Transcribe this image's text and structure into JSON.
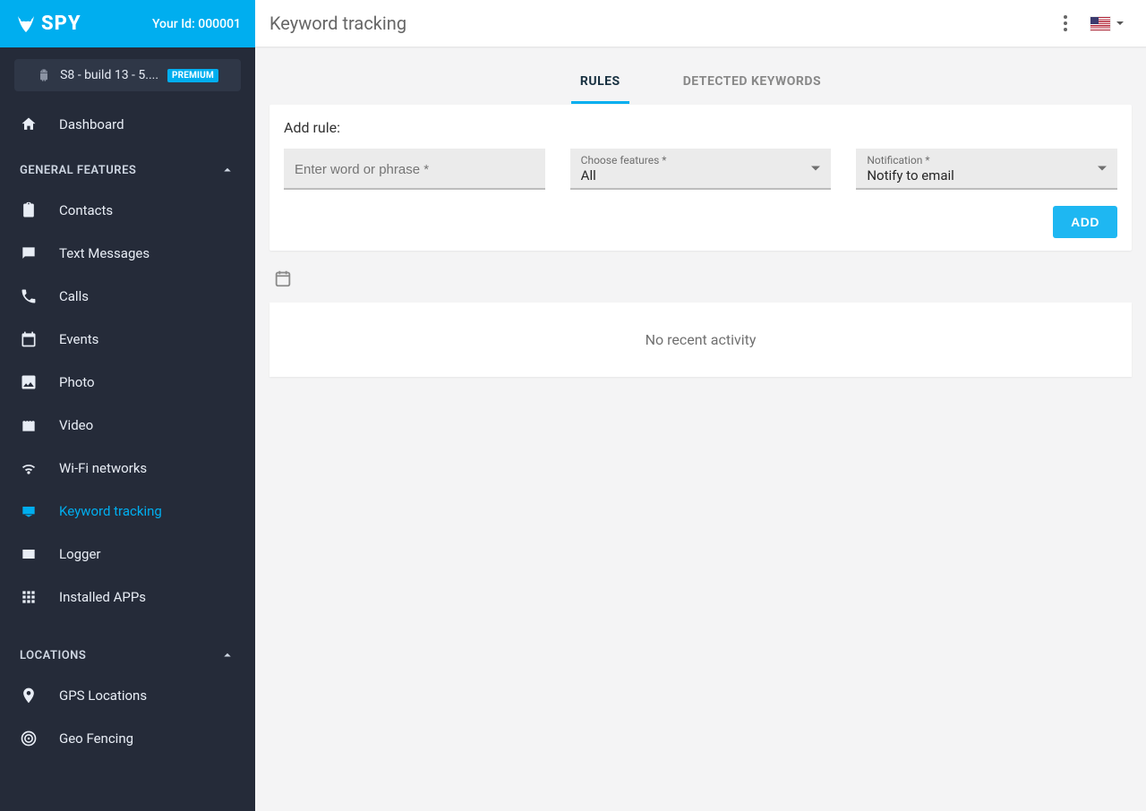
{
  "brand": {
    "name": "SPY",
    "user_id_label": "Your Id: 000001"
  },
  "device": {
    "name": "S8 - build 13 - 5....",
    "badge": "PREMIUM"
  },
  "sidebar": {
    "dashboard": "Dashboard",
    "sections": [
      {
        "title": "GENERAL FEATURES",
        "items": [
          {
            "key": "contacts",
            "label": "Contacts"
          },
          {
            "key": "text-messages",
            "label": "Text Messages"
          },
          {
            "key": "calls",
            "label": "Calls"
          },
          {
            "key": "events",
            "label": "Events"
          },
          {
            "key": "photo",
            "label": "Photo"
          },
          {
            "key": "video",
            "label": "Video"
          },
          {
            "key": "wifi",
            "label": "Wi-Fi networks"
          },
          {
            "key": "keyword-tracking",
            "label": "Keyword tracking",
            "active": true
          },
          {
            "key": "logger",
            "label": "Logger"
          },
          {
            "key": "installed-apps",
            "label": "Installed APPs"
          }
        ]
      },
      {
        "title": "LOCATIONS",
        "items": [
          {
            "key": "gps",
            "label": "GPS Locations"
          },
          {
            "key": "geofencing",
            "label": "Geo Fencing"
          }
        ]
      }
    ]
  },
  "header": {
    "page_title": "Keyword tracking"
  },
  "tabs": [
    {
      "key": "rules",
      "label": "RULES",
      "active": true
    },
    {
      "key": "detected",
      "label": "DETECTED KEYWORDS"
    }
  ],
  "rule_form": {
    "title": "Add rule:",
    "keyword_placeholder": "Enter word or phrase *",
    "features_label": "Choose features *",
    "features_value": "All",
    "notification_label": "Notification *",
    "notification_value": "Notify to email",
    "add_button": "ADD"
  },
  "activity": {
    "empty_text": "No recent activity"
  }
}
